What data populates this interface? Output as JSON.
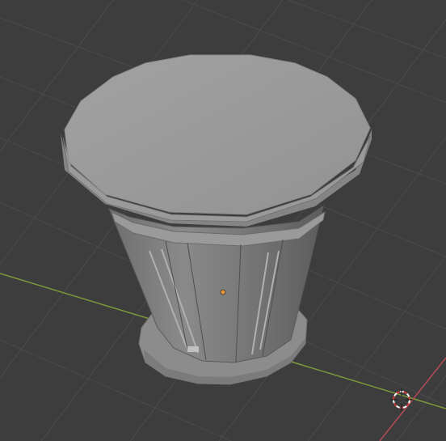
{
  "viewport": {
    "background": "#3d3d3d",
    "grid_color": "#484848",
    "x_axis_color": "#7d9a3a",
    "y_axis_color": "#b54b57",
    "origin_color": "#e8973a"
  },
  "scene": {
    "object_type": "trash-can",
    "body_color": "#8f8f8f",
    "cursor_icon": "3d-cursor-icon"
  }
}
